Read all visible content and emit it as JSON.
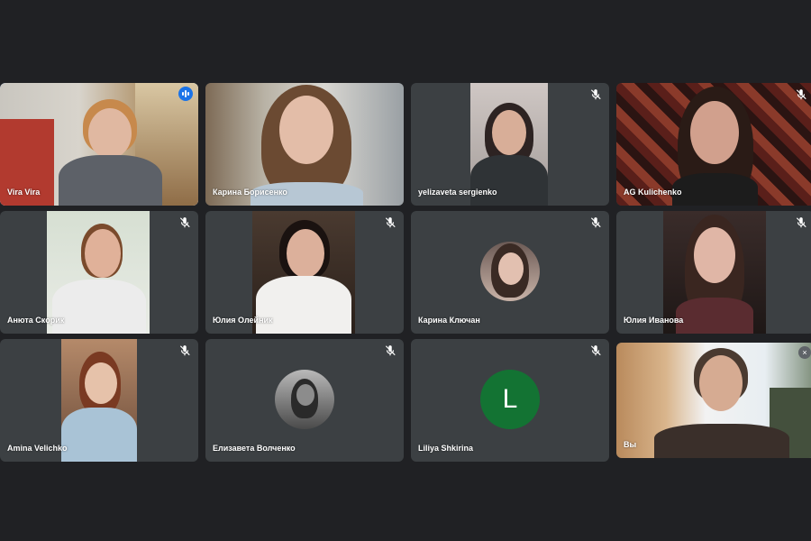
{
  "meeting": {
    "participants": [
      {
        "name": "Vira Vira",
        "state": "speaking"
      },
      {
        "name": "Карина Борисенко",
        "state": "unmuted"
      },
      {
        "name": "yelizaveta sergienko",
        "state": "muted"
      },
      {
        "name": "AG Kulichenko",
        "state": "muted"
      },
      {
        "name": "Анюта Скорик",
        "state": "muted"
      },
      {
        "name": "Юлия Олейник",
        "state": "muted"
      },
      {
        "name": "Карина Ключан",
        "state": "muted"
      },
      {
        "name": "Юлия Иванова",
        "state": "muted"
      },
      {
        "name": "Amina Velichko",
        "state": "muted"
      },
      {
        "name": "Елизавета Волченко",
        "state": "muted"
      },
      {
        "name": "Liliya Shkirina",
        "state": "muted",
        "avatar_letter": "L"
      },
      {
        "name": "Вы",
        "state": "self"
      }
    ]
  },
  "colors": {
    "background": "#202124",
    "tile": "#3c4043",
    "speaking_outline": "#4b8df8",
    "avatar_green": "#137333"
  },
  "icons": {
    "mic_off": "mic-off-icon",
    "speaking": "audio-level-icon"
  }
}
